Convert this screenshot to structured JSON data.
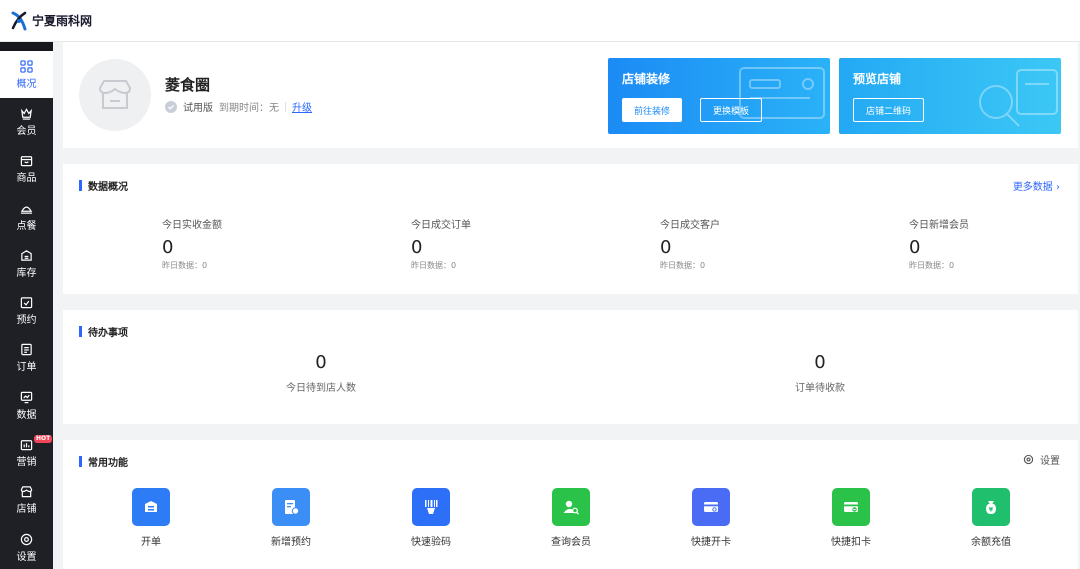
{
  "header": {
    "logo_text": "宁夏雨科网"
  },
  "sidebar": {
    "items": [
      {
        "label": "概况",
        "icon": "grid-icon"
      },
      {
        "label": "会员",
        "icon": "crown-icon"
      },
      {
        "label": "商品",
        "icon": "bag-icon"
      },
      {
        "label": "点餐",
        "icon": "dish-icon"
      },
      {
        "label": "库存",
        "icon": "inventory-icon"
      },
      {
        "label": "预约",
        "icon": "calendar-check-icon"
      },
      {
        "label": "订单",
        "icon": "order-list-icon"
      },
      {
        "label": "数据",
        "icon": "monitor-chart-icon"
      },
      {
        "label": "营销",
        "icon": "marketing-icon",
        "badge": "HOT"
      },
      {
        "label": "店铺",
        "icon": "shop-icon"
      },
      {
        "label": "设置",
        "icon": "gear-icon"
      }
    ],
    "active_color": "#2d66ff",
    "bg_color": "#1f2026"
  },
  "store": {
    "name": "菱食圈",
    "edition": "试用版",
    "expire": "到期时间：无",
    "upgrade": "升级"
  },
  "promo": {
    "decorate": {
      "title": "店铺装修",
      "btn_primary": "前往装修",
      "btn_secondary": "更换模板"
    },
    "preview": {
      "title": "预览店铺",
      "btn": "店铺二维码"
    }
  },
  "overview": {
    "title": "数据概况",
    "more": "更多数据 ›",
    "stats": [
      {
        "label": "今日实收金额",
        "value": "0",
        "sub": "昨日数据：0"
      },
      {
        "label": "今日成交订单",
        "value": "0",
        "sub": "昨日数据：0"
      },
      {
        "label": "今日成交客户",
        "value": "0",
        "sub": "昨日数据：0"
      },
      {
        "label": "今日新增会员",
        "value": "0",
        "sub": "昨日数据：0"
      }
    ]
  },
  "todo": {
    "title": "待办事项",
    "items": [
      {
        "value": "0",
        "label": "今日待到店人数"
      },
      {
        "value": "0",
        "label": "订单待收款"
      }
    ]
  },
  "functions": {
    "title": "常用功能",
    "settings": "设置",
    "items": [
      {
        "label": "开单",
        "icon": "open-order-icon",
        "color": "#2d7cf6"
      },
      {
        "label": "新增预约",
        "icon": "new-reservation-icon",
        "color": "#3a8ef6"
      },
      {
        "label": "快速验码",
        "icon": "barcode-verify-icon",
        "color": "#2d6ff7"
      },
      {
        "label": "查询会员",
        "icon": "member-search-icon",
        "color": "#2bc24a"
      },
      {
        "label": "快捷开卡",
        "icon": "card-open-icon",
        "color": "#4a6cf5"
      },
      {
        "label": "快捷扣卡",
        "icon": "card-deduct-icon",
        "color": "#2bc24a"
      },
      {
        "label": "余额充值",
        "icon": "balance-recharge-icon",
        "color": "#1fbf6e"
      }
    ]
  }
}
